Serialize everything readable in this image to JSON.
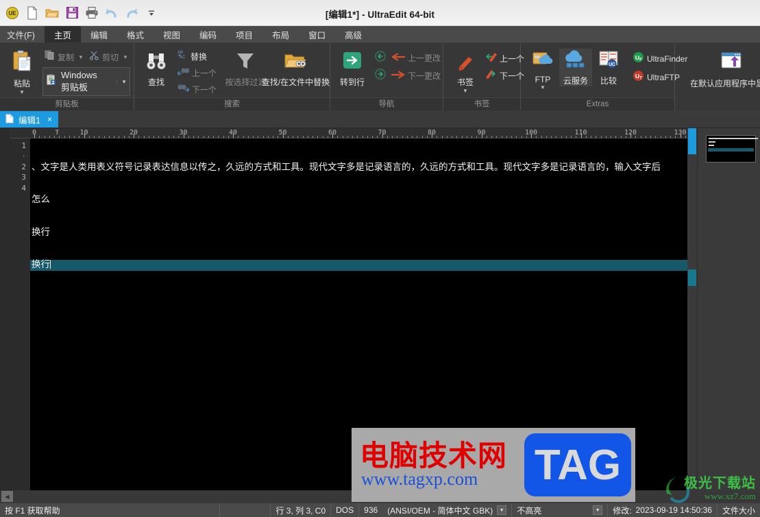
{
  "window": {
    "title": "[编辑1*] - UltraEdit 64-bit"
  },
  "quick_access": [
    {
      "name": "ue-logo-icon",
      "label": "UE"
    },
    {
      "name": "new-file-icon",
      "label": "新建"
    },
    {
      "name": "open-folder-icon",
      "label": "打开"
    },
    {
      "name": "save-icon",
      "label": "保存"
    },
    {
      "name": "print-icon",
      "label": "打印"
    },
    {
      "name": "undo-icon",
      "label": "撤销"
    },
    {
      "name": "redo-icon",
      "label": "重做"
    },
    {
      "name": "customize-qat-icon",
      "label": "自定义"
    }
  ],
  "menubar": {
    "items": [
      {
        "label": "文件(F)",
        "active": false
      },
      {
        "label": "主页",
        "active": true
      },
      {
        "label": "编辑",
        "active": false
      },
      {
        "label": "格式",
        "active": false
      },
      {
        "label": "视图",
        "active": false
      },
      {
        "label": "编码",
        "active": false
      },
      {
        "label": "项目",
        "active": false
      },
      {
        "label": "布局",
        "active": false
      },
      {
        "label": "窗口",
        "active": false
      },
      {
        "label": "高级",
        "active": false
      }
    ]
  },
  "ribbon": {
    "groups": [
      {
        "id": "clipboard",
        "title": "剪贴板",
        "paste_label": "粘贴",
        "copy_label": "复制",
        "cut_label": "剪切",
        "windows_clipboard_label": "Windows 剪贴板"
      },
      {
        "id": "search",
        "title": "搜索",
        "find_label": "查找",
        "replace_label": "替换",
        "prev_label": "上一个",
        "next_label": "下一个",
        "filter_label": "按选择过滤",
        "find_in_files_label": "查找/在文件中替换"
      },
      {
        "id": "navigation",
        "title": "导航",
        "goto_line_label": "转到行",
        "prev_change_label": "上一更改",
        "next_change_label": "下一更改"
      },
      {
        "id": "bookmark",
        "title": "书签",
        "bookmark_label": "书签",
        "prev_label": "上一个",
        "next_label": "下一个"
      },
      {
        "id": "extras",
        "title": "Extras",
        "ftp_label": "FTP",
        "cloud_label": "云服务",
        "compare_label": "比较",
        "ultrafinder_label": "UltraFinder",
        "ultraftp_label": "UltraFTP"
      },
      {
        "id": "open-with",
        "title": "",
        "show_in_default_app_label": "在默认应用程序中显示"
      }
    ]
  },
  "tabs": [
    {
      "label": "编辑1",
      "close": "×",
      "active": true
    }
  ],
  "ruler": {
    "labels": [
      "0",
      "10",
      "20",
      "30",
      "40",
      "50",
      "60",
      "70",
      "80",
      "90",
      "100",
      "110",
      "120",
      "130"
    ],
    "tab_marker": "T"
  },
  "editor": {
    "lines": [
      {
        "num": "1",
        "text": "、文字是人类用表义符号记录表达信息以传之，久远的方式和工具。现代文字多是记录语言的，久远的方式和工具。现代文字多是记录语言的，输入文字后",
        "current": false,
        "wrapped": false
      },
      {
        "num": "·",
        "text": "怎么",
        "current": false,
        "wrapped": true
      },
      {
        "num": "2",
        "text": "换行",
        "current": false,
        "wrapped": false
      },
      {
        "num": "3",
        "text": "换行",
        "current": true,
        "wrapped": false
      },
      {
        "num": "4",
        "text": "",
        "current": false,
        "wrapped": false
      }
    ]
  },
  "statusbar": {
    "help_hint": "按 F1 获取帮助",
    "cursor_pos": "行 3, 列 3, C0",
    "line_ending": "DOS",
    "codepage": "936",
    "encoding": "(ANSI/OEM - 简体中文 GBK)",
    "highlight": "不高亮",
    "modified_label": "修改:",
    "modified_value": "2023-09-19 14:50:36",
    "filesize_label": "文件大小"
  },
  "watermarks": {
    "tag": {
      "zh": "电脑技术网",
      "url": "www.tagxp.com",
      "badge": "TAG"
    },
    "jiguang": {
      "zh": "极光下载站",
      "url": "www.xz7.com"
    }
  },
  "colors": {
    "accent": "#1e9ae0",
    "ribbon_bg": "#373737",
    "editor_bg": "#000000",
    "current_line": "#15596b",
    "titlebar_bg": "#eeeeee",
    "statusbar_bg": "#4a4a4a"
  }
}
